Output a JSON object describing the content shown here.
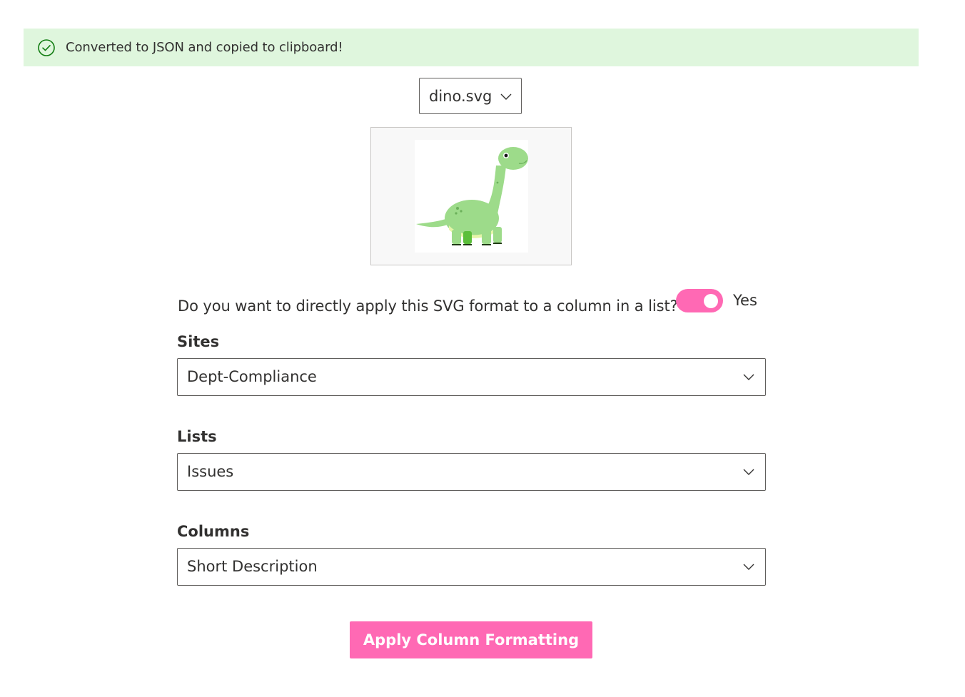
{
  "banner": {
    "message": "Converted to JSON and copied to clipboard!",
    "icon": "check-circle-icon",
    "background": "#dff6dd",
    "icon_color": "#107c10"
  },
  "file_select": {
    "value": "dino.svg",
    "icon": "chevron-down-icon"
  },
  "preview": {
    "image": "dinosaur-image"
  },
  "apply_toggle": {
    "question": "Do you want to directly apply this SVG format to a column in a list?",
    "state_label": "Yes",
    "on": true,
    "color": "#ff69b4"
  },
  "sites": {
    "label": "Sites",
    "value": "Dept-Compliance"
  },
  "lists": {
    "label": "Lists",
    "value": "Issues"
  },
  "columns": {
    "label": "Columns",
    "value": "Short Description"
  },
  "apply_button": {
    "label": "Apply Column Formatting",
    "color": "#ff69b4"
  }
}
